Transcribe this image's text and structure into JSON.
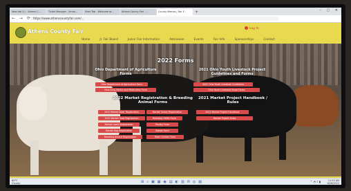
{
  "browser": {
    "tabs": [
      {
        "label": "New tab (1) - Athens C..."
      },
      {
        "label": "Ticket Manager - Jimdo..."
      },
      {
        "label": "Start Tab - Welcome to..."
      },
      {
        "label": "Athens County Fair - ..."
      },
      {
        "label": "County Memos | Fair F..."
      }
    ],
    "url": "https://www.athenscountyfair.com/..."
  },
  "site": {
    "title": "Athens County Fair",
    "login": "Log In",
    "nav": [
      "Home",
      "Jr. Fair Board",
      "Junior Fair Information",
      "Admission",
      "Events",
      "Fair Info",
      "Sponsorships",
      "Contact"
    ]
  },
  "hero": {
    "main_heading": "2022 Forms",
    "section1": "Ohio Department of Agriculture Forms",
    "section2": "2021 Ohio Youth Livestock Project Guidelines and Forms",
    "section3": "2022 Market Registration & Breeding Animal Forms",
    "section4": "2021 Market Project Handbook / Rules",
    "buttons_col1": [
      "Ohio Department of Agriculture Form",
      "Ohio Drug Notice and Medication Form",
      "2022 Market Steer Registration",
      "2022 Market Goat Registration",
      "Market Lamb Registration",
      "Market Hog Registration",
      "Breeding Animal Registration"
    ],
    "buttons_col2": [
      "Market Turkey Registration",
      "Breeding Heifer Form",
      "Poultry Form",
      "Rabbit Form",
      "Meat Chicken Form"
    ],
    "buttons_col3": [
      "2021 Ohio Youth Livestock Guidelines",
      "Ohio Youth Livestock Show Forms",
      "2021 Market Project Handbook",
      "Market Project Rules"
    ]
  },
  "taskbar": {
    "weather_temp": "69°F",
    "weather_desc": "Cloudy",
    "time": "11:53 AM",
    "date": "6/28/2022"
  }
}
